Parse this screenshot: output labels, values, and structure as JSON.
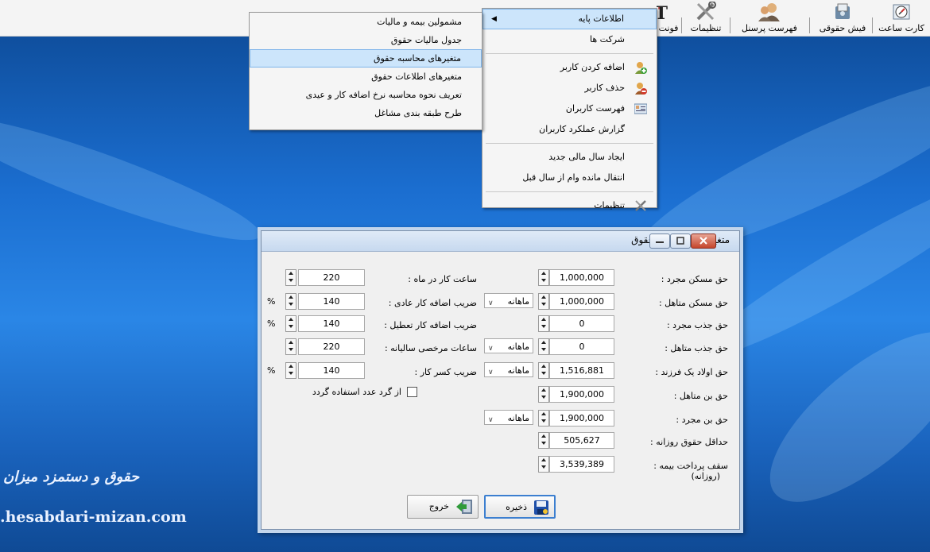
{
  "toolbar": {
    "items": [
      {
        "label": "کارت ساعت",
        "icon": "clock-card-icon"
      },
      {
        "label": "فیش حقوقی",
        "icon": "payslip-icon"
      },
      {
        "label": "فهرست پرسنل",
        "icon": "personnel-icon"
      },
      {
        "label": "تنظیمات",
        "icon": "settings-tools-icon"
      },
      {
        "label": "فونت",
        "icon": "font-icon"
      }
    ]
  },
  "main_menu": {
    "items": [
      {
        "label": "اطلاعات پایه",
        "has_submenu": true
      },
      {
        "label": "شرکت ها"
      },
      {
        "label": "اضافه کردن کاربر",
        "icon": "add-user-icon"
      },
      {
        "label": "حذف کاربر",
        "icon": "delete-user-icon"
      },
      {
        "label": "فهرست کاربران",
        "icon": "user-list-icon"
      },
      {
        "label": "گزارش عملکرد کاربران"
      },
      {
        "label": "ایجاد سال مالی جدید"
      },
      {
        "label": "انتقال مانده وام از سال قبل"
      },
      {
        "label": "تنظیمات",
        "icon": "settings-tools-icon"
      }
    ]
  },
  "submenu": {
    "items": [
      {
        "label": "مشمولین بیمه و مالیات"
      },
      {
        "label": "جدول مالیات حقوق"
      },
      {
        "label": "متغیرهای محاسبه حقوق"
      },
      {
        "label": "متغیرهای اطلاعات حقوق"
      },
      {
        "label": "تعریف نحوه محاسبه نرخ اضافه کار و عیدی"
      },
      {
        "label": "طرح طبقه بندی مشاغل"
      }
    ]
  },
  "dialog": {
    "title": "متغیر های محاسبه حقوق",
    "right_fields": [
      {
        "label": "حق مسکن مجرد :",
        "value": "1,000,000",
        "period": ""
      },
      {
        "label": "حق مسکن متاهل :",
        "value": "1,000,000",
        "period": "ماهانه"
      },
      {
        "label": "حق جذب مجرد :",
        "value": "0",
        "period": ""
      },
      {
        "label": "حق جذب متاهل :",
        "value": "0",
        "period": "ماهانه"
      },
      {
        "label": "حق اولاد یک فرزند :",
        "value": "1,516,881",
        "period": "ماهانه"
      },
      {
        "label": "حق بن متاهل :",
        "value": "1,900,000",
        "period": ""
      },
      {
        "label": "حق بن مجرد :",
        "value": "1,900,000",
        "period": "ماهانه"
      },
      {
        "label": "حداقل حقوق روزانه :",
        "value": "505,627",
        "period": ""
      },
      {
        "label": "سقف پرداخت بیمه :",
        "label2": "(روزانه)",
        "value": "3,539,389",
        "period": ""
      }
    ],
    "left_fields": [
      {
        "label": "ساعت کار در ماه :",
        "value": "220",
        "pct": ""
      },
      {
        "label": "ضریب اضافه کار عادی :",
        "value": "140",
        "pct": "%"
      },
      {
        "label": "ضریب اضافه کار تعطیل :",
        "value": "140",
        "pct": "%"
      },
      {
        "label": "ساعات مرخصی سالیانه :",
        "value": "220",
        "pct": ""
      },
      {
        "label": "ضریب کسر کار :",
        "value": "140",
        "pct": "%"
      }
    ],
    "checkbox_label": "از گرد عدد استفاده گردد",
    "save_label": "ذخیره",
    "exit_label": "خروج"
  },
  "background": {
    "slogan": "حقوق و دستمزد میزان",
    "url": ".hesabdari-mizan.com"
  }
}
